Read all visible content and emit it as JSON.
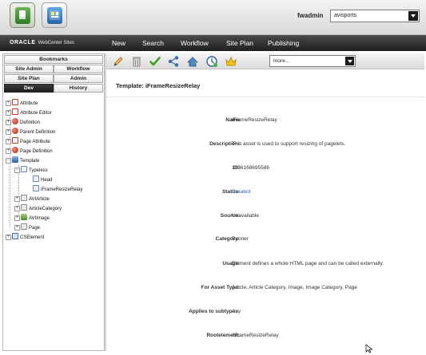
{
  "header": {
    "apps": [
      {
        "name": "admin-app"
      },
      {
        "name": "contributor-app"
      }
    ],
    "user": "fwadmin",
    "site": "avisports"
  },
  "navbar": {
    "brand": "ORACLE",
    "product": "WebCenter Sites",
    "items": [
      "New",
      "Search",
      "Workflow",
      "Site Plan",
      "Publishing"
    ]
  },
  "left_tabs": {
    "bookmarks": "Bookmarks",
    "site_admin": "Site Admin",
    "workflow": "Workflow",
    "site_plan": "Site Plan",
    "admin": "Admin",
    "dev": "Dev",
    "history": "History"
  },
  "tree": [
    {
      "label": "Attribute",
      "icon": "attribute-icon"
    },
    {
      "label": "Attribute Editor",
      "icon": "attribute-editor-icon"
    },
    {
      "label": "Definition",
      "icon": "definition-icon"
    },
    {
      "label": "Parent Definition",
      "icon": "parent-definition-icon"
    },
    {
      "label": "Page Attribute",
      "icon": "page-attribute-icon"
    },
    {
      "label": "Page Definition",
      "icon": "page-definition-icon"
    },
    {
      "label": "Template",
      "icon": "template-icon"
    },
    {
      "label": "Typeless",
      "icon": "typeless-icon"
    },
    {
      "label": "Head",
      "icon": "template-item-icon"
    },
    {
      "label": "iFrameResizeRelay",
      "icon": "template-item-icon"
    },
    {
      "label": "AVIArticle",
      "icon": "folder-icon"
    },
    {
      "label": "ArticleCategory",
      "icon": "folder-icon"
    },
    {
      "label": "AVIImage",
      "icon": "folder-icon"
    },
    {
      "label": "Page",
      "icon": "folder-icon"
    },
    {
      "label": "CSElement",
      "icon": "cselement-icon"
    }
  ],
  "toolbar": {
    "tools": [
      "edit-icon",
      "delete-icon",
      "approve-icon",
      "share-icon",
      "preview-icon",
      "status-icon",
      "bookmark-icon"
    ],
    "more": "more..."
  },
  "asset": {
    "title": "Template: iFrameResizeRelay",
    "fields": [
      {
        "label": "Name",
        "value": "iFrameResizeRelay"
      },
      {
        "label": "Description:",
        "value": "This asset is used to support resizing of pagelets."
      },
      {
        "label": "ID:",
        "value": "1336168695586"
      },
      {
        "label": "Status:",
        "value": "Created"
      },
      {
        "label": "Source:",
        "value": "Unavailable"
      },
      {
        "label": "Category:",
        "value": "Banner"
      },
      {
        "label": "Usage:",
        "value": "Element defines a whole HTML page and can be called externally."
      },
      {
        "label": "For Asset Type:",
        "value": "Article, Article Category, Image, Image Category, Page"
      },
      {
        "label": "Applies to subtypes:",
        "value": "Any"
      },
      {
        "label": "Rootelement:",
        "value": "/iFrameResizeRelay"
      }
    ]
  },
  "colors": {
    "link": "#3565a8",
    "nav_bg": "#2a2a2a",
    "selected_tab_bg": "#2a2a2a"
  }
}
